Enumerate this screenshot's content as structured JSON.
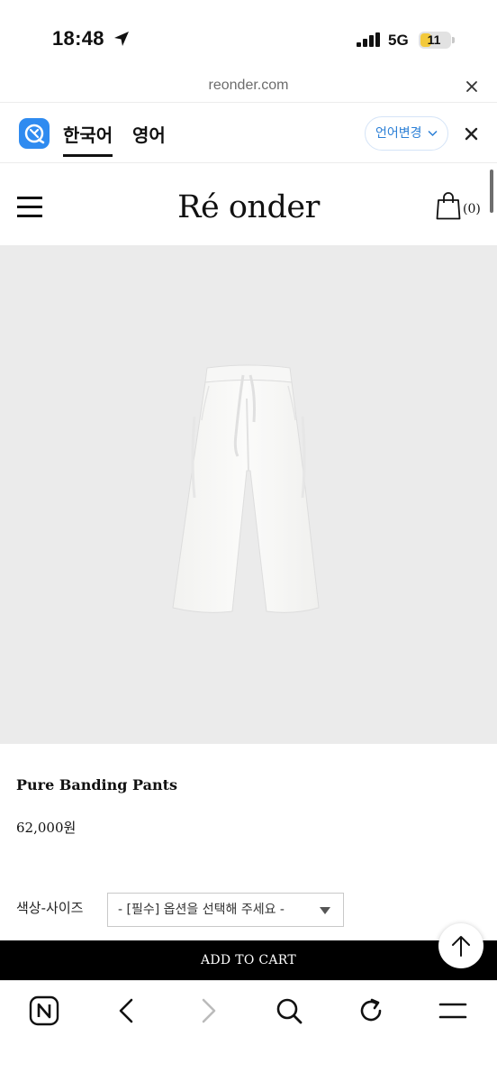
{
  "status": {
    "time": "18:48",
    "network": "5G",
    "battery": "11",
    "battery_level": 0.11,
    "icons": [
      "location-arrow-icon",
      "signal-bars-icon"
    ]
  },
  "url_bar": {
    "domain": "reonder.com",
    "close_icon": "close-icon"
  },
  "translate": {
    "tab_active": "한국어",
    "tab_other": "영어",
    "change_label": "언어변경",
    "accent": "#2f8bf0",
    "logo_icon": "translate-logo-icon"
  },
  "shop_header": {
    "brand": "Ré onder",
    "cart_count": "(0)",
    "menu_icon": "hamburger-menu-icon",
    "cart_icon": "shopping-bag-icon"
  },
  "product": {
    "name": "Pure Banding Pants",
    "price": "62,000원",
    "image_bg": "#ebebeb"
  },
  "options": {
    "label": "색상-사이즈",
    "placeholder": "- [필수] 옵션을 선택해 주세요 -"
  },
  "cart_button": {
    "label": "ADD TO CART"
  },
  "browser_bar": {
    "items": [
      "naver-home-icon",
      "back-arrow-icon",
      "forward-arrow-icon",
      "search-icon",
      "reload-icon",
      "menu-icon"
    ]
  }
}
